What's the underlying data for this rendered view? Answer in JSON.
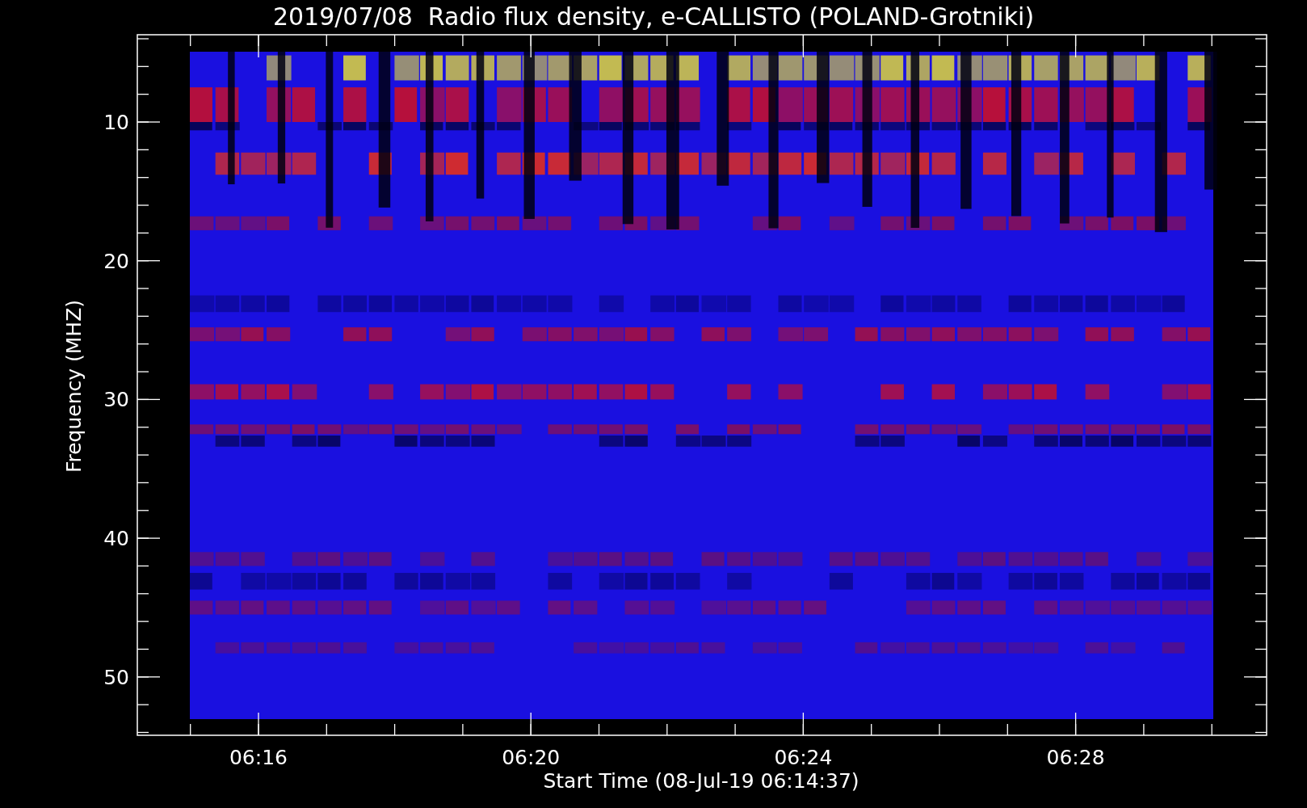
{
  "title": "2019/07/08  Radio flux density, e-CALLISTO (POLAND-Grotniki)",
  "plot": {
    "xlabel": "Start Time (08-Jul-19 06:14:37)",
    "ylabel": "Frequency (MHZ)",
    "xticks": [
      "06:16",
      "06:20",
      "06:24",
      "06:28"
    ],
    "yticks": [
      "10",
      "20",
      "30",
      "40",
      "50"
    ]
  }
}
